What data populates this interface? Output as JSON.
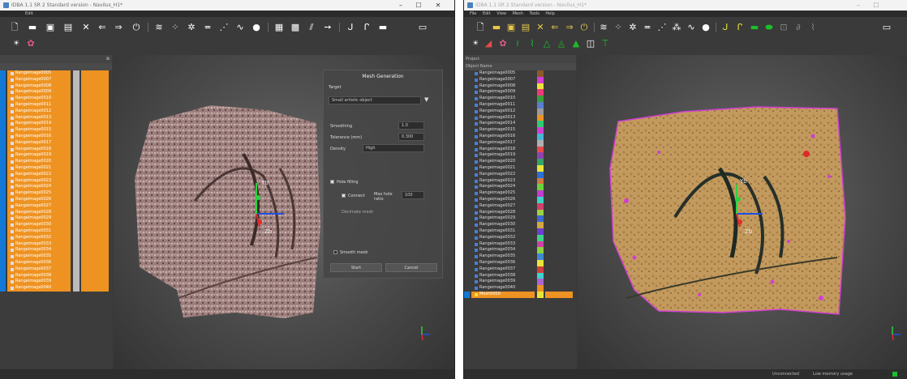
{
  "colors": {
    "orange": "#ee9322",
    "blue": "#1479d6",
    "magenta": "#d23fd2",
    "yellow": "#e8e43a",
    "green": "#1bbd2a"
  },
  "left": {
    "title": "IDBA 1.1 SR 2 Standard version - Navilus_H1*",
    "menu": [
      "Edit"
    ],
    "objects": [
      "Rangeimage0005",
      "Rangeimage0007",
      "Rangeimage0008",
      "Rangeimage0009",
      "Rangeimage0010",
      "Rangeimage0011",
      "Rangeimage0012",
      "Rangeimage0013",
      "Rangeimage0014",
      "Rangeimage0015",
      "Rangeimage0016",
      "Rangeimage0017",
      "Rangeimage0018",
      "Rangeimage0019",
      "Rangeimage0020",
      "Rangeimage0021",
      "Rangeimage0022",
      "Rangeimage0023",
      "Rangeimage0024",
      "Rangeimage0025",
      "Rangeimage0026",
      "Rangeimage0027",
      "Rangeimage0028",
      "Rangeimage0029",
      "Rangeimage0030",
      "Rangeimage0031",
      "Rangeimage0032",
      "Rangeimage0033",
      "Rangeimage0034",
      "Rangeimage0035",
      "Rangeimage0036",
      "Rangeimage0037",
      "Rangeimage0038",
      "Rangeimage0039",
      "Rangeimage0040"
    ],
    "dialog": {
      "title": "Mesh Generation",
      "target_label": "Target",
      "target_value": "Small artistic object",
      "smoothing_label": "Smoothing",
      "smoothing_value": "1.0",
      "tolerance_label": "Tolerance (mm)",
      "tolerance_value": "0.300",
      "density_label": "Density",
      "density_value": "High",
      "hole_filling": "Hole filling",
      "connect_label": "Connect",
      "max_hole_label": "Max hole ratio",
      "max_hole_value": "100",
      "decimate_label": "Decimate mesh",
      "smooth_mesh": "Smooth mesh",
      "start": "Start",
      "cancel": "Cancel"
    },
    "axes": {
      "y": "Yb",
      "z": "Zb"
    }
  },
  "right": {
    "title": "IDBA 1.1 SR 2 Standard version - Navilus_H1*",
    "menu": [
      "File",
      "Edit",
      "View",
      "Mesh",
      "Tools",
      "Help"
    ],
    "panel_title": "Project",
    "column_title": "Object Name",
    "objects": [
      "Rangeimage0005",
      "Rangeimage0007",
      "Rangeimage0008",
      "Rangeimage0009",
      "Rangeimage0010",
      "Rangeimage0011",
      "Rangeimage0012",
      "Rangeimage0013",
      "Rangeimage0014",
      "Rangeimage0015",
      "Rangeimage0016",
      "Rangeimage0017",
      "Rangeimage0018",
      "Rangeimage0019",
      "Rangeimage0020",
      "Rangeimage0021",
      "Rangeimage0022",
      "Rangeimage0023",
      "Rangeimage0024",
      "Rangeimage0025",
      "Rangeimage0026",
      "Rangeimage0027",
      "Rangeimage0028",
      "Rangeimage0029",
      "Rangeimage0030",
      "Rangeimage0031",
      "Rangeimage0032",
      "Rangeimage0033",
      "Rangeimage0034",
      "Rangeimage0035",
      "Rangeimage0036",
      "Rangeimage0037",
      "Rangeimage0038",
      "Rangeimage0039",
      "Rangeimage0040"
    ],
    "selected_object": "Mesh0000",
    "swatches": [
      "#8b5a2b",
      "#d23fd2",
      "#e8e43a",
      "#ee3a7a",
      "#3c9d3c",
      "#5a7fd0",
      "#9a9a9a",
      "#ee9322",
      "#2ecc71",
      "#d23fd2",
      "#4ab6d6",
      "#b0b0b0",
      "#e84a4a",
      "#8e44ad",
      "#34a36a",
      "#e8e43a",
      "#2e6fd6",
      "#d2783f",
      "#6ad23f",
      "#c43ad2",
      "#3ad2c4",
      "#d23f6a",
      "#9cd23f",
      "#3f6ad2",
      "#d2a83f",
      "#6a3fd2",
      "#3fd28a",
      "#d23fa8",
      "#8ad23f",
      "#3f8ad2",
      "#e8e43a",
      "#d23f3f",
      "#3fd2d2",
      "#aa66cc",
      "#ee9322"
    ],
    "axes": {
      "y": "Yb",
      "z": "Zb"
    },
    "status": [
      "Unconnected",
      "Low memory usage"
    ]
  }
}
